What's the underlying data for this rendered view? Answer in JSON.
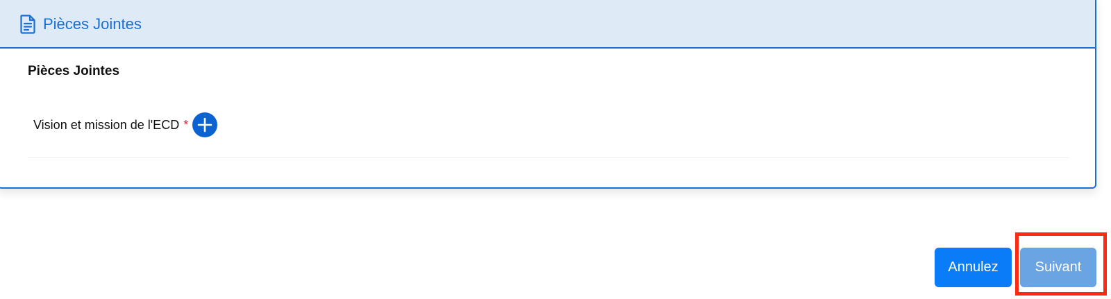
{
  "panel": {
    "header_title": "Pièces Jointes",
    "header_icon": "file-text-icon",
    "section_title": "Pièces Jointes",
    "field": {
      "label": "Vision et mission de l'ECD",
      "required_marker": "*",
      "add_icon": "plus-circle-icon"
    }
  },
  "actions": {
    "cancel_label": "Annulez",
    "next_label": "Suivant"
  },
  "colors": {
    "accent": "#1a6fd6",
    "header_bg": "#dfeaf7",
    "cancel_bg": "#0a7cf8",
    "next_bg": "#6aa4e3",
    "required": "#e0263c",
    "highlight": "#ff2a12"
  }
}
